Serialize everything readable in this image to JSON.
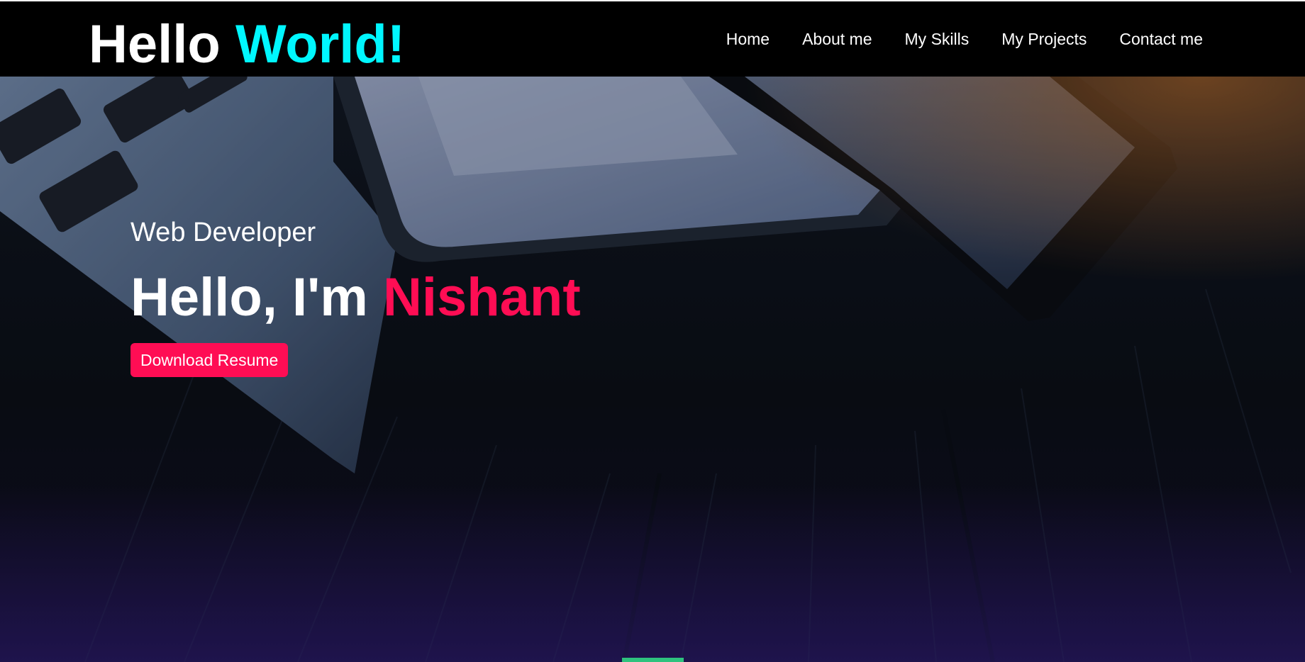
{
  "brand": {
    "part1": "Hello",
    "part2": "World!"
  },
  "nav": {
    "items": [
      {
        "label": "Home"
      },
      {
        "label": "About me"
      },
      {
        "label": "My Skills"
      },
      {
        "label": "My Projects"
      },
      {
        "label": "Contact me"
      }
    ]
  },
  "hero": {
    "subtitle": "Web Developer",
    "greeting": "Hello, I'm",
    "name": "Nishant",
    "button_label": "Download Resume",
    "background_description_icon": "laptop-tablet-photo"
  },
  "colors": {
    "brand_accent": "#00f7ff",
    "name_accent": "#ff0d54",
    "navbar_bg": "#000000",
    "indicator": "#2ec27e"
  }
}
